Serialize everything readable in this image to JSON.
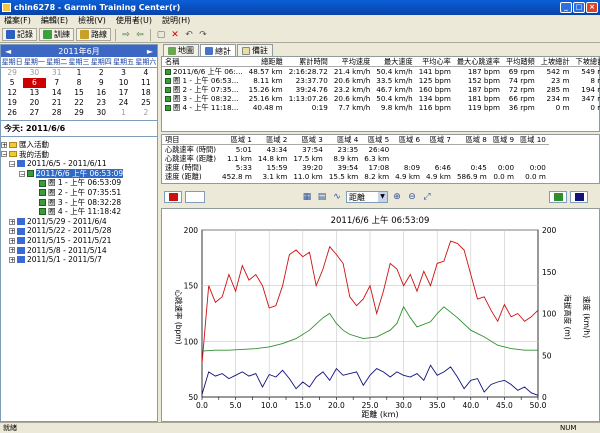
{
  "window": {
    "title": "chin6278 - Garmin Training Center(r)"
  },
  "menu": [
    "檔案(F)",
    "編輯(E)",
    "檢視(V)",
    "使用者(U)",
    "說明(H)"
  ],
  "toolbar": {
    "record": "記錄",
    "training": "訓練",
    "route": "路線"
  },
  "calendar": {
    "month": "2011年6月",
    "dow": [
      "星期日",
      "星期一",
      "星期二",
      "星期三",
      "星期四",
      "星期五",
      "星期六"
    ],
    "days": [
      [
        "29",
        "30",
        "31",
        "1",
        "2",
        "3",
        "4"
      ],
      [
        "5",
        "6",
        "7",
        "8",
        "9",
        "10",
        "11"
      ],
      [
        "12",
        "13",
        "14",
        "15",
        "16",
        "17",
        "18"
      ],
      [
        "19",
        "20",
        "21",
        "22",
        "23",
        "24",
        "25"
      ],
      [
        "26",
        "27",
        "28",
        "29",
        "30",
        "1",
        "2"
      ]
    ],
    "today_label": "今天: 2011/6/6"
  },
  "tree": {
    "inbox": "匯入活動",
    "mine": "我的活動",
    "week1": "2011/6/5 - 2011/6/11",
    "activity": "2011/6/6 上午 06:53:09",
    "laps": [
      "圈 1 - 上午 06:53:09",
      "圈 2 - 上午 07:35:51",
      "圈 3 - 上午 08:32:28",
      "圈 4 - 上午 11:18:42"
    ],
    "weeks": [
      "2011/5/29 - 2011/6/4",
      "2011/5/22 - 2011/5/28",
      "2011/5/15 - 2011/5/21",
      "2011/5/8 - 2011/5/14",
      "2011/5/1 - 2011/5/7"
    ]
  },
  "tabs": {
    "map": "地圖",
    "total": "總計",
    "notes": "備註"
  },
  "summary": {
    "headers": [
      "名稱",
      "總距離",
      "累計時間",
      "平均速度",
      "最大速度",
      "平均心率",
      "最大心跳速率",
      "平均踏頻",
      "上坡總計",
      "下坡總計"
    ],
    "rows": [
      [
        "2011/6/6 上午 06:...",
        "48.57 km",
        "2:16:28.72",
        "21.4 km/h",
        "50.4 km/h",
        "141 bpm",
        "187 bpm",
        "69 rpm",
        "542 m",
        "549 m"
      ],
      [
        "圈 1 - 上午 06:53...",
        "8.11 km",
        "23:37.70",
        "20.6 km/h",
        "33.5 km/h",
        "125 bpm",
        "152 bpm",
        "74 rpm",
        "23 m",
        "8 m"
      ],
      [
        "圈 2 - 上午 07:35...",
        "15.26 km",
        "39:24.76",
        "23.2 km/h",
        "46.7 km/h",
        "160 bpm",
        "187 bpm",
        "72 rpm",
        "285 m",
        "194 m"
      ],
      [
        "圈 3 - 上午 08:32...",
        "25.16 km",
        "1:13:07.26",
        "20.6 km/h",
        "50.4 km/h",
        "134 bpm",
        "181 bpm",
        "66 rpm",
        "234 m",
        "347 m"
      ],
      [
        "圈 4 - 上午 11:18...",
        "40.48 m",
        "0:19",
        "7.7 km/h",
        "9.8 km/h",
        "116 bpm",
        "119 bpm",
        "36 rpm",
        "0 m",
        "0 m"
      ]
    ]
  },
  "zones": {
    "headers": [
      "項目",
      "區域 1",
      "區域 2",
      "區域 3",
      "區域 4",
      "區域 5",
      "區域 6",
      "區域 7",
      "區域 8",
      "區域 9",
      "區域 10"
    ],
    "rows": [
      [
        "心跳速率 (時間)",
        "5:01",
        "43:34",
        "37:54",
        "23:35",
        "26:40",
        "",
        "",
        "",
        "",
        ""
      ],
      [
        "心跳速率 (距離)",
        "1.1 km",
        "14.8 km",
        "17.5 km",
        "8.9 km",
        "6.3 km",
        "",
        "",
        "",
        "",
        ""
      ],
      [
        "速度 (時間)",
        "5:33",
        "15:59",
        "39:20",
        "39:54",
        "17:08",
        "8:09",
        "6:46",
        "0:45",
        "0:00",
        "0:00"
      ],
      [
        "速度 (距離)",
        "452.8 m",
        "3.1 km",
        "11.0 km",
        "15.5 km",
        "8.2 km",
        "4.9 km",
        "4.9 km",
        "586.9 m",
        "0.0 m",
        "0.0 m"
      ]
    ]
  },
  "graph_controls": {
    "xaxis_select": "距離"
  },
  "chart_data": {
    "type": "line",
    "title": "2011/6/6 上午 06:53:09",
    "xlabel": "距離 (km)",
    "ylabel_left": "心跳速率 (bpm)",
    "ylabel_right_1": "海拔高度 (m)",
    "ylabel_right_2": "速度 (km/h)",
    "x_ticks": [
      "0.0",
      "2.5",
      "5.0",
      "7.5",
      "10.0",
      "12.5",
      "15.0",
      "17.5",
      "20.0",
      "22.5",
      "25.0",
      "27.5",
      "30.0",
      "32.5",
      "35.0",
      "37.5",
      "40.0",
      "42.5",
      "45.0",
      "47.5",
      "50.0"
    ],
    "y_left_ticks": [
      "50",
      "100",
      "150",
      "200"
    ],
    "y_right_ticks": [
      "0",
      "50",
      "100",
      "150",
      "200"
    ],
    "xlim": [
      0,
      50
    ],
    "ylim_left": [
      50,
      200
    ],
    "ylim_right": [
      0,
      200
    ],
    "series": [
      {
        "color": "#cc1111",
        "x": [
          0,
          1,
          2,
          3,
          4,
          5,
          6,
          7,
          8,
          9,
          10,
          11,
          12,
          13,
          14,
          15,
          16,
          17,
          18,
          19,
          20,
          21,
          22,
          23,
          24,
          25,
          26,
          27,
          28,
          29,
          30,
          31,
          32,
          33,
          34,
          35,
          36,
          37,
          38,
          39,
          40,
          41,
          42,
          43,
          44,
          45,
          46,
          47,
          48,
          49,
          50
        ],
        "values": [
          80,
          150,
          135,
          140,
          160,
          145,
          168,
          155,
          160,
          150,
          130,
          132,
          150,
          178,
          182,
          176,
          180,
          150,
          165,
          185,
          178,
          170,
          140,
          132,
          138,
          150,
          125,
          145,
          170,
          165,
          150,
          160,
          145,
          163,
          150,
          170,
          172,
          190,
          188,
          182,
          160,
          138,
          140,
          128,
          118,
          133,
          122,
          125,
          118,
          122,
          128
        ]
      },
      {
        "color": "#2f8f2f",
        "x": [
          0,
          2,
          4,
          6,
          8,
          10,
          12,
          14,
          16,
          18,
          19,
          20,
          21,
          22,
          24,
          26,
          28,
          29,
          30,
          31,
          32,
          34,
          35,
          36,
          38,
          40,
          42,
          44,
          46,
          48,
          50
        ],
        "values": [
          55,
          56,
          56,
          57,
          58,
          60,
          64,
          70,
          80,
          95,
          100,
          88,
          80,
          75,
          70,
          72,
          80,
          88,
          108,
          95,
          84,
          90,
          100,
          108,
          95,
          80,
          72,
          62,
          58,
          56,
          56
        ]
      },
      {
        "color": "#12127a",
        "x": [
          0,
          1,
          2,
          3,
          4,
          5,
          6,
          7,
          8,
          9,
          10,
          11,
          12,
          13,
          14,
          15,
          16,
          17,
          18,
          19,
          20,
          21,
          22,
          23,
          24,
          25,
          26,
          27,
          28,
          29,
          30,
          31,
          32,
          33,
          34,
          35,
          36,
          37,
          38,
          39,
          40,
          41,
          42,
          43,
          44,
          45,
          46,
          47,
          48,
          49,
          50
        ],
        "values": [
          3,
          30,
          25,
          28,
          22,
          26,
          30,
          25,
          28,
          12,
          27,
          24,
          32,
          22,
          10,
          18,
          12,
          24,
          30,
          20,
          34,
          26,
          28,
          30,
          14,
          26,
          34,
          30,
          24,
          30,
          26,
          24,
          28,
          20,
          38,
          26,
          30,
          36,
          24,
          10,
          20,
          22,
          6,
          15,
          18,
          20,
          15,
          8,
          12,
          5,
          2
        ]
      }
    ]
  },
  "status": {
    "left": "就緒",
    "right": "NUM"
  }
}
